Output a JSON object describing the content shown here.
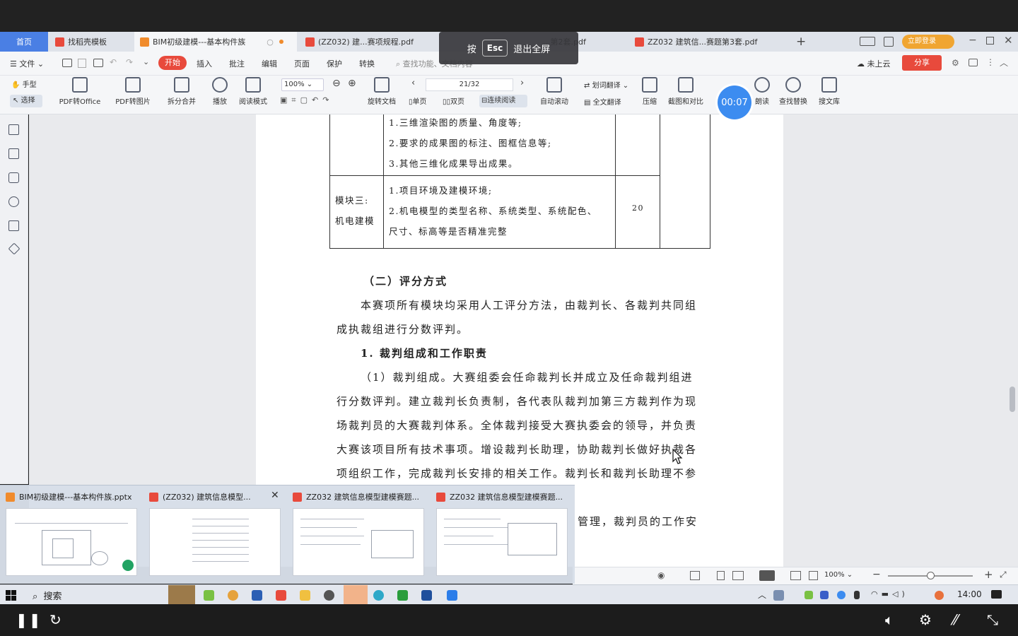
{
  "tabs": [
    {
      "label": "首页",
      "color": "#4a7fe4"
    },
    {
      "label": "找稻壳模板",
      "color": "#e84a3c"
    },
    {
      "label": "BIM初级建模---基本构件族",
      "color": "#f08b2c"
    },
    {
      "label": "(ZZ032) 建...赛项规程.pdf",
      "color": "#e84a3c"
    },
    {
      "label": "...第2套.pdf",
      "color": "#e84a3c"
    },
    {
      "label": "ZZ032 建筑信...赛题第3套.pdf",
      "color": "#e84a3c"
    }
  ],
  "new_tab_icon": "+",
  "login_label": "立即登录",
  "esc_banner": {
    "press": "按",
    "key": "Esc",
    "exit": "退出全屏"
  },
  "menubar": {
    "items": [
      "文件",
      "开始",
      "插入",
      "批注",
      "编辑",
      "页面",
      "保护",
      "转换"
    ],
    "search_placeholder": "查找功能、文档内容",
    "cloud": "未上云",
    "share": "分享"
  },
  "toolbar": {
    "hand": "手型",
    "select": "选择",
    "tools": [
      "PDF转Office",
      "PDF转图片",
      "拆分合并",
      "播放",
      "阅读模式",
      "旋转文档",
      "自动滚动",
      "压缩",
      "截图和对比",
      "朗读",
      "查找替换",
      "搜文库"
    ],
    "zoom": "100%",
    "page": "21/32",
    "single_page": "单页",
    "double_page": "双页",
    "continuous": "连续阅读",
    "translate_word": "划词翻译",
    "translate_full": "全文翻译"
  },
  "timer": "00:07",
  "document": {
    "table": {
      "row1_items": [
        "1.三维渲染图的质量、角度等;",
        "2.要求的成果图的标注、图框信息等;",
        "3.其他三维化成果导出成果。"
      ],
      "row2_module_line1": "模块三:",
      "row2_module_line2": "机电建模",
      "row2_items": [
        "1.项目环境及建模环境;",
        "2.机电模型的类型名称、系统类型、系统配色、",
        "尺寸、标高等是否精准完整"
      ],
      "row2_score": "20"
    },
    "heading": "（二）评分方式",
    "para1_line1": "本赛项所有模块均采用人工评分方法，由裁判长、各裁判共同组",
    "para1_line2": "成执裁组进行分数评判。",
    "subheading": "1. 裁判组成和工作职责",
    "para2_lines": [
      "（1）裁判组成。大赛组委会任命裁判长并成立及任命裁判组进",
      "行分数评判。建立裁判长负责制，各代表队裁判加第三方裁判作为现",
      "场裁判员的大赛裁判体系。全体裁判接受大赛执委会的领导，并负责",
      "大赛该项目所有技术事项。增设裁判长助理，协助裁判长做好执裁各",
      "项组织工作，完成裁判长安排的相关工作。裁判长和裁判长助理不参"
    ],
    "para3_partial": "管理，裁判员的工作安"
  },
  "status": {
    "zoom": "100%"
  },
  "thumbnails": [
    {
      "title": "BIM初级建模---基本构件族.pptx",
      "color": "#f08b2c"
    },
    {
      "title": "(ZZ032) 建筑信息模型...",
      "color": "#e84a3c"
    },
    {
      "title": "ZZ032 建筑信息模型建模赛题...",
      "color": "#e84a3c"
    },
    {
      "title": "ZZ032 建筑信息模型建模赛题...",
      "color": "#e84a3c"
    }
  ],
  "taskbar": {
    "search": "搜索",
    "time": "14:00"
  }
}
